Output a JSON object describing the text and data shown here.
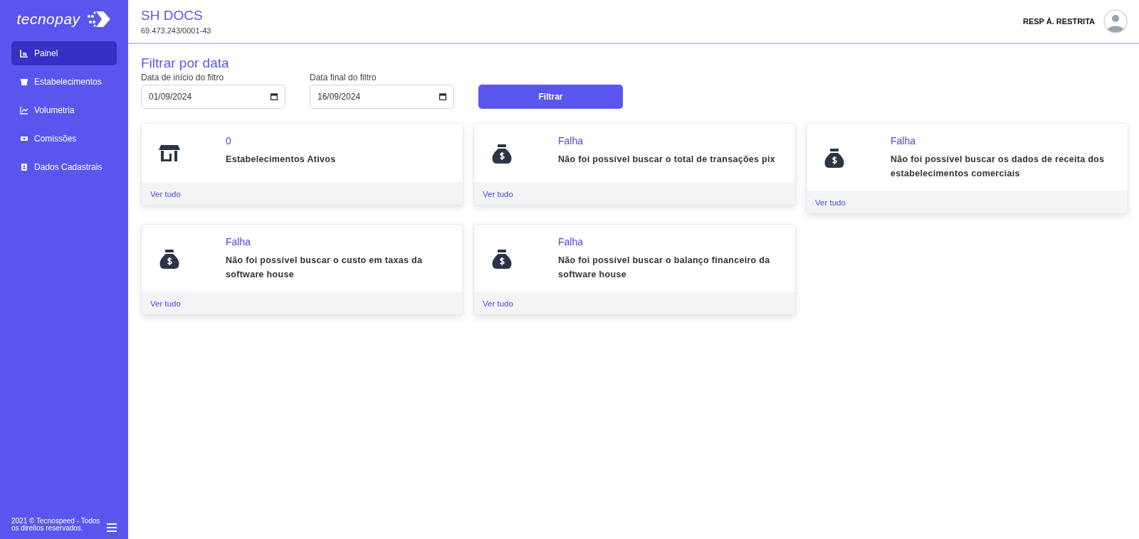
{
  "sidebar": {
    "logo": "tecnopay",
    "items": [
      {
        "label": "Painel",
        "kind": "chart",
        "selected": true
      },
      {
        "label": "Estabelecimentos",
        "kind": "store",
        "selected": false
      },
      {
        "label": "Volumetria",
        "kind": "line",
        "selected": false
      },
      {
        "label": "Comissões",
        "kind": "money",
        "selected": false
      },
      {
        "label": "Dados Cadastrais",
        "kind": "card",
        "selected": false
      }
    ],
    "footer": "2021 © Tecnospeed - Todos os direitos reservados."
  },
  "header": {
    "title": "SH DOCS",
    "subtitle": "69.473.243/0001-43",
    "user": "RESP Á. RESTRITA"
  },
  "filter": {
    "title": "Filtrar por data",
    "fields": [
      {
        "label": "Data de início do filtro",
        "value": "01/09/2024"
      },
      {
        "label": "Data final do filtro",
        "value": "16/09/2024"
      }
    ],
    "button": "Filtrar"
  },
  "cards": [
    {
      "kind": "store",
      "value": "0",
      "text": "Estabelecimentos Ativos",
      "link": "Ver tudo"
    },
    {
      "kind": "money",
      "value": "Falha",
      "text": "Não foi possível buscar o total de transações pix",
      "link": "Ver tudo"
    },
    {
      "kind": "money",
      "value": "Falha",
      "text": "Não foi possível buscar os dados de receita dos estabelecimentos comerciais",
      "link": "Ver tudo"
    },
    {
      "kind": "money",
      "value": "Falha",
      "text": "Não foi possível buscar o custo em taxas da software house",
      "link": "Ver tudo"
    },
    {
      "kind": "money",
      "value": "Falha",
      "text": "Não foi possível buscar o balanço financeiro da software house",
      "link": "Ver tudo"
    }
  ]
}
